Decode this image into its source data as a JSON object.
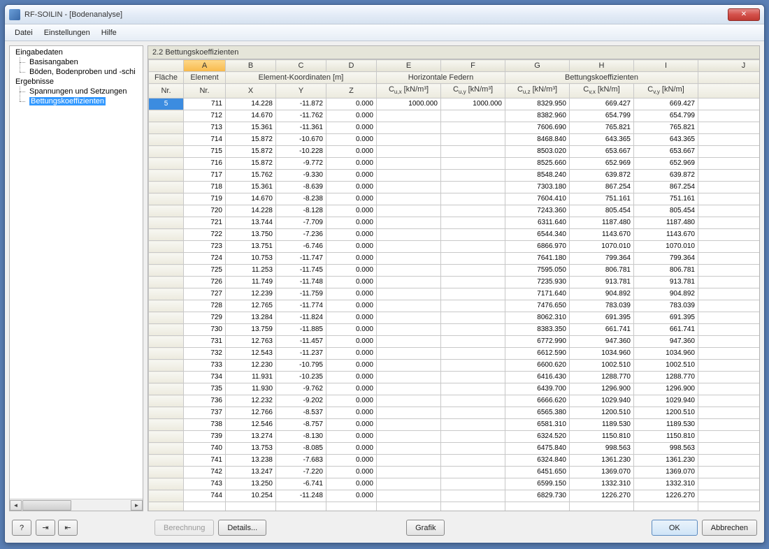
{
  "window": {
    "title": "RF-SOILIN - [Bodenanalyse]"
  },
  "menubar": {
    "items": [
      "Datei",
      "Einstellungen",
      "Hilfe"
    ]
  },
  "sidebar": {
    "groups": [
      {
        "label": "Eingabedaten",
        "children": [
          "Basisangaben",
          "Böden, Bodenproben und -schi"
        ]
      },
      {
        "label": "Ergebnisse",
        "children": [
          "Spannungen und Setzungen",
          "Bettungskoeffizienten"
        ]
      }
    ],
    "selected": "Bettungskoeffizienten"
  },
  "main": {
    "title": "2.2 Bettungskoeffizienten"
  },
  "grid": {
    "letters": [
      "A",
      "B",
      "C",
      "D",
      "E",
      "F",
      "G",
      "H",
      "I",
      "J"
    ],
    "group_headers": {
      "flaeche": "Fläche",
      "element": "Element",
      "koord": "Element-Koordinaten [m]",
      "horiz": "Horizontale Federn",
      "bett": "Bettungskoeffizienten"
    },
    "col_headers": {
      "nr": "Nr.",
      "elem_nr": "Nr.",
      "x": "X",
      "y": "Y",
      "z": "Z",
      "cux": "C<sub>u,x</sub> [kN/m³]",
      "cuy": "C<sub>u,y</sub> [kN/m³]",
      "cuz": "C<sub>u,z</sub> [kN/m³]",
      "cvx": "C<sub>v,x</sub> [kN/m]",
      "cvy": "C<sub>v,y</sub> [kN/m]"
    },
    "selected_row_flaeche": "5",
    "rows": [
      {
        "e": 711,
        "x": "14.228",
        "y": "-11.872",
        "z": "0.000",
        "cux": "1000.000",
        "cuy": "1000.000",
        "cuz": "8329.950",
        "cvx": "669.427",
        "cvy": "669.427"
      },
      {
        "e": 712,
        "x": "14.670",
        "y": "-11.762",
        "z": "0.000",
        "cux": "",
        "cuy": "",
        "cuz": "8382.960",
        "cvx": "654.799",
        "cvy": "654.799"
      },
      {
        "e": 713,
        "x": "15.361",
        "y": "-11.361",
        "z": "0.000",
        "cux": "",
        "cuy": "",
        "cuz": "7606.690",
        "cvx": "765.821",
        "cvy": "765.821"
      },
      {
        "e": 714,
        "x": "15.872",
        "y": "-10.670",
        "z": "0.000",
        "cux": "",
        "cuy": "",
        "cuz": "8468.840",
        "cvx": "643.365",
        "cvy": "643.365"
      },
      {
        "e": 715,
        "x": "15.872",
        "y": "-10.228",
        "z": "0.000",
        "cux": "",
        "cuy": "",
        "cuz": "8503.020",
        "cvx": "653.667",
        "cvy": "653.667"
      },
      {
        "e": 716,
        "x": "15.872",
        "y": "-9.772",
        "z": "0.000",
        "cux": "",
        "cuy": "",
        "cuz": "8525.660",
        "cvx": "652.969",
        "cvy": "652.969"
      },
      {
        "e": 717,
        "x": "15.762",
        "y": "-9.330",
        "z": "0.000",
        "cux": "",
        "cuy": "",
        "cuz": "8548.240",
        "cvx": "639.872",
        "cvy": "639.872"
      },
      {
        "e": 718,
        "x": "15.361",
        "y": "-8.639",
        "z": "0.000",
        "cux": "",
        "cuy": "",
        "cuz": "7303.180",
        "cvx": "867.254",
        "cvy": "867.254"
      },
      {
        "e": 719,
        "x": "14.670",
        "y": "-8.238",
        "z": "0.000",
        "cux": "",
        "cuy": "",
        "cuz": "7604.410",
        "cvx": "751.161",
        "cvy": "751.161"
      },
      {
        "e": 720,
        "x": "14.228",
        "y": "-8.128",
        "z": "0.000",
        "cux": "",
        "cuy": "",
        "cuz": "7243.360",
        "cvx": "805.454",
        "cvy": "805.454"
      },
      {
        "e": 721,
        "x": "13.744",
        "y": "-7.709",
        "z": "0.000",
        "cux": "",
        "cuy": "",
        "cuz": "6311.640",
        "cvx": "1187.480",
        "cvy": "1187.480"
      },
      {
        "e": 722,
        "x": "13.750",
        "y": "-7.236",
        "z": "0.000",
        "cux": "",
        "cuy": "",
        "cuz": "6544.340",
        "cvx": "1143.670",
        "cvy": "1143.670"
      },
      {
        "e": 723,
        "x": "13.751",
        "y": "-6.746",
        "z": "0.000",
        "cux": "",
        "cuy": "",
        "cuz": "6866.970",
        "cvx": "1070.010",
        "cvy": "1070.010"
      },
      {
        "e": 724,
        "x": "10.753",
        "y": "-11.747",
        "z": "0.000",
        "cux": "",
        "cuy": "",
        "cuz": "7641.180",
        "cvx": "799.364",
        "cvy": "799.364"
      },
      {
        "e": 725,
        "x": "11.253",
        "y": "-11.745",
        "z": "0.000",
        "cux": "",
        "cuy": "",
        "cuz": "7595.050",
        "cvx": "806.781",
        "cvy": "806.781"
      },
      {
        "e": 726,
        "x": "11.749",
        "y": "-11.748",
        "z": "0.000",
        "cux": "",
        "cuy": "",
        "cuz": "7235.930",
        "cvx": "913.781",
        "cvy": "913.781"
      },
      {
        "e": 727,
        "x": "12.239",
        "y": "-11.759",
        "z": "0.000",
        "cux": "",
        "cuy": "",
        "cuz": "7171.640",
        "cvx": "904.892",
        "cvy": "904.892"
      },
      {
        "e": 728,
        "x": "12.765",
        "y": "-11.774",
        "z": "0.000",
        "cux": "",
        "cuy": "",
        "cuz": "7476.650",
        "cvx": "783.039",
        "cvy": "783.039"
      },
      {
        "e": 729,
        "x": "13.284",
        "y": "-11.824",
        "z": "0.000",
        "cux": "",
        "cuy": "",
        "cuz": "8062.310",
        "cvx": "691.395",
        "cvy": "691.395"
      },
      {
        "e": 730,
        "x": "13.759",
        "y": "-11.885",
        "z": "0.000",
        "cux": "",
        "cuy": "",
        "cuz": "8383.350",
        "cvx": "661.741",
        "cvy": "661.741"
      },
      {
        "e": 731,
        "x": "12.763",
        "y": "-11.457",
        "z": "0.000",
        "cux": "",
        "cuy": "",
        "cuz": "6772.990",
        "cvx": "947.360",
        "cvy": "947.360"
      },
      {
        "e": 732,
        "x": "12.543",
        "y": "-11.237",
        "z": "0.000",
        "cux": "",
        "cuy": "",
        "cuz": "6612.590",
        "cvx": "1034.960",
        "cvy": "1034.960"
      },
      {
        "e": 733,
        "x": "12.230",
        "y": "-10.795",
        "z": "0.000",
        "cux": "",
        "cuy": "",
        "cuz": "6600.620",
        "cvx": "1002.510",
        "cvy": "1002.510"
      },
      {
        "e": 734,
        "x": "11.931",
        "y": "-10.235",
        "z": "0.000",
        "cux": "",
        "cuy": "",
        "cuz": "6416.430",
        "cvx": "1288.770",
        "cvy": "1288.770"
      },
      {
        "e": 735,
        "x": "11.930",
        "y": "-9.762",
        "z": "0.000",
        "cux": "",
        "cuy": "",
        "cuz": "6439.700",
        "cvx": "1296.900",
        "cvy": "1296.900"
      },
      {
        "e": 736,
        "x": "12.232",
        "y": "-9.202",
        "z": "0.000",
        "cux": "",
        "cuy": "",
        "cuz": "6666.620",
        "cvx": "1029.940",
        "cvy": "1029.940"
      },
      {
        "e": 737,
        "x": "12.766",
        "y": "-8.537",
        "z": "0.000",
        "cux": "",
        "cuy": "",
        "cuz": "6565.380",
        "cvx": "1200.510",
        "cvy": "1200.510"
      },
      {
        "e": 738,
        "x": "12.546",
        "y": "-8.757",
        "z": "0.000",
        "cux": "",
        "cuy": "",
        "cuz": "6581.310",
        "cvx": "1189.530",
        "cvy": "1189.530"
      },
      {
        "e": 739,
        "x": "13.274",
        "y": "-8.130",
        "z": "0.000",
        "cux": "",
        "cuy": "",
        "cuz": "6324.520",
        "cvx": "1150.810",
        "cvy": "1150.810"
      },
      {
        "e": 740,
        "x": "13.753",
        "y": "-8.085",
        "z": "0.000",
        "cux": "",
        "cuy": "",
        "cuz": "6475.840",
        "cvx": "998.563",
        "cvy": "998.563"
      },
      {
        "e": 741,
        "x": "13.238",
        "y": "-7.683",
        "z": "0.000",
        "cux": "",
        "cuy": "",
        "cuz": "6324.840",
        "cvx": "1361.230",
        "cvy": "1361.230"
      },
      {
        "e": 742,
        "x": "13.247",
        "y": "-7.220",
        "z": "0.000",
        "cux": "",
        "cuy": "",
        "cuz": "6451.650",
        "cvx": "1369.070",
        "cvy": "1369.070"
      },
      {
        "e": 743,
        "x": "13.250",
        "y": "-6.741",
        "z": "0.000",
        "cux": "",
        "cuy": "",
        "cuz": "6599.150",
        "cvx": "1332.310",
        "cvy": "1332.310"
      },
      {
        "e": 744,
        "x": "10.254",
        "y": "-11.248",
        "z": "0.000",
        "cux": "",
        "cuy": "",
        "cuz": "6829.730",
        "cvx": "1226.270",
        "cvy": "1226.270"
      }
    ]
  },
  "footer": {
    "berechnung": "Berechnung",
    "details": "Details...",
    "grafik": "Grafik",
    "ok": "OK",
    "abbrechen": "Abbrechen"
  }
}
